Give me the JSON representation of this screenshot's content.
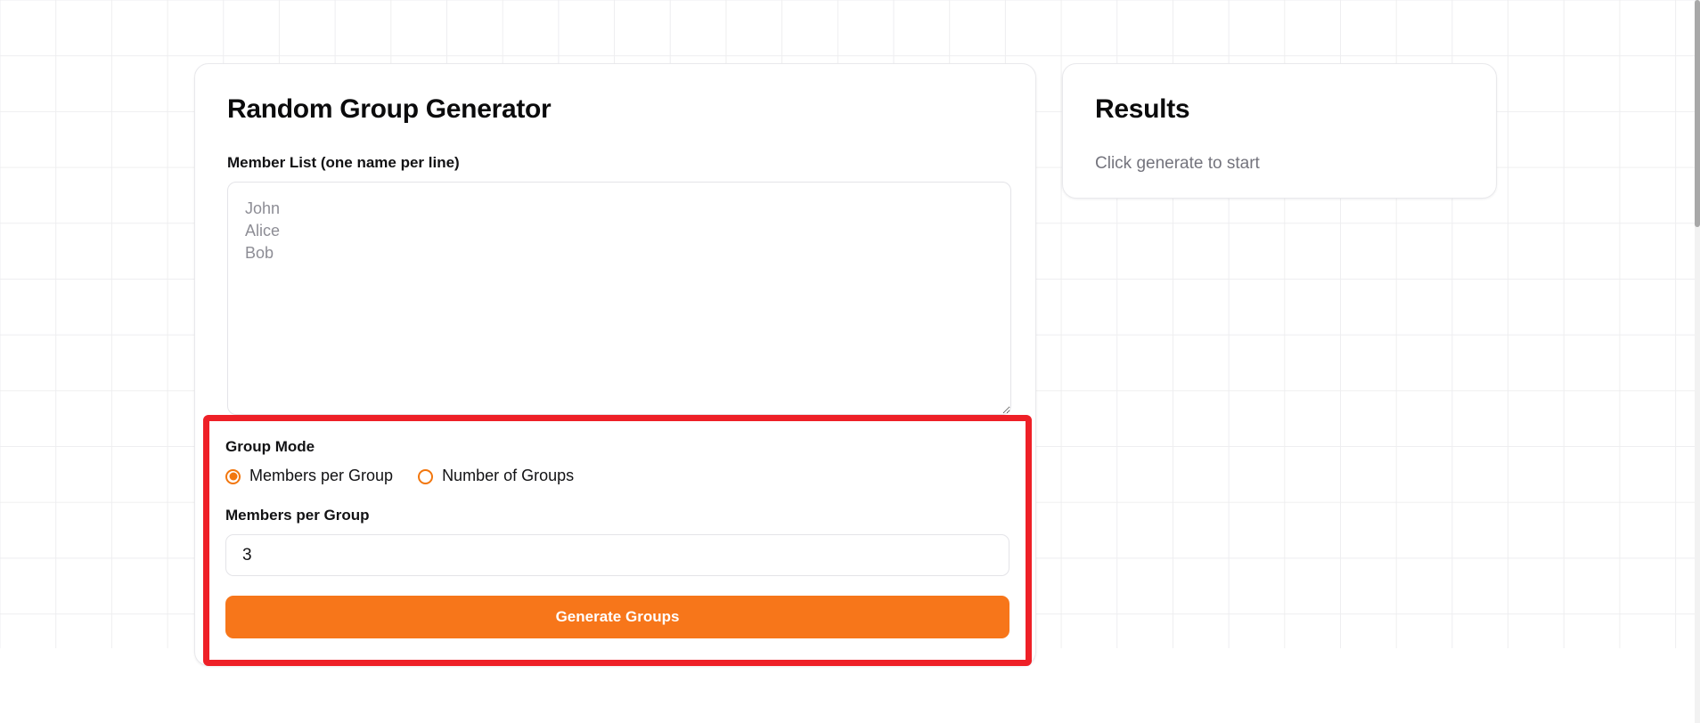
{
  "background": {
    "grid_color": "#eeeef0",
    "page_color": "#ffffff"
  },
  "colors": {
    "accent_orange": "#f7761a",
    "radio_orange": "#f2760d",
    "highlight_red": "#ee2027",
    "text_primary": "#121214",
    "text_muted": "#74747d",
    "placeholder": "#8d8d95",
    "border": "#e4e4e8"
  },
  "generator": {
    "title": "Random Group Generator",
    "member_list": {
      "label": "Member List (one name per line)",
      "value": "",
      "placeholder": "John\nAlice\nBob"
    },
    "group_mode": {
      "label": "Group Mode",
      "options": [
        {
          "label": "Members per Group",
          "selected": true
        },
        {
          "label": "Number of Groups",
          "selected": false
        }
      ]
    },
    "count_field": {
      "label": "Members per Group",
      "value": "3"
    },
    "generate_button": {
      "label": "Generate Groups"
    }
  },
  "results": {
    "title": "Results",
    "empty_text": "Click generate to start"
  }
}
